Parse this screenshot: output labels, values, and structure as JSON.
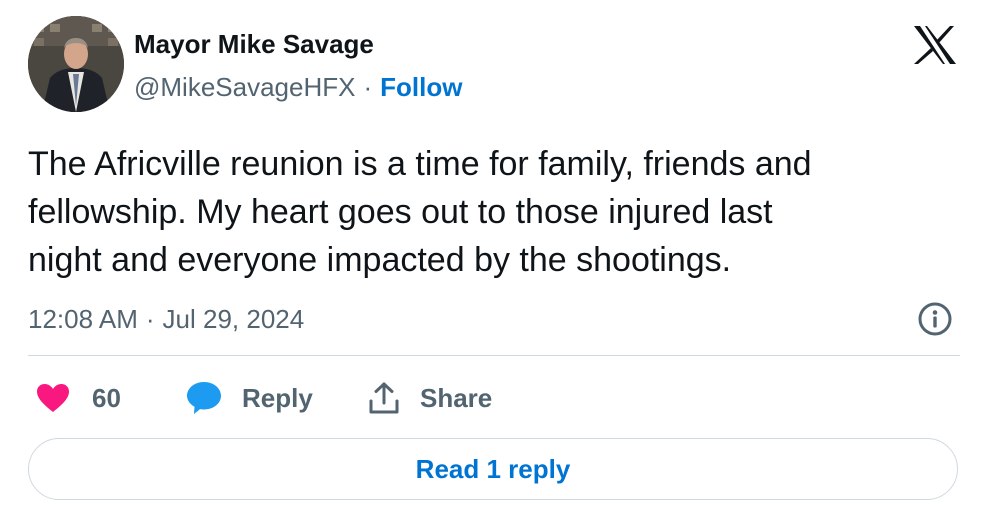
{
  "author": {
    "display_name": "Mayor Mike Savage",
    "handle": "@MikeSavageHFX",
    "separator": "·",
    "follow_label": "Follow"
  },
  "tweet": {
    "lines": [
      "The Africville reunion is a time for family, friends and",
      "fellowship. My heart goes out to those injured last",
      "night and everyone impacted by the shootings."
    ],
    "time": "12:08 AM",
    "separator": "·",
    "date": "Jul 29, 2024"
  },
  "actions": {
    "like_count": "60",
    "reply_label": "Reply",
    "share_label": "Share"
  },
  "read_replies_label": "Read 1 reply",
  "colors": {
    "link_blue": "#0074d3",
    "like_pink": "#f91880",
    "reply_blue": "#1d9bf0",
    "muted_text": "#536471"
  },
  "icons": {
    "logo": "x-logo-icon",
    "info": "info-icon",
    "like": "heart-icon",
    "reply": "speech-bubble-icon",
    "share": "share-upload-icon"
  }
}
